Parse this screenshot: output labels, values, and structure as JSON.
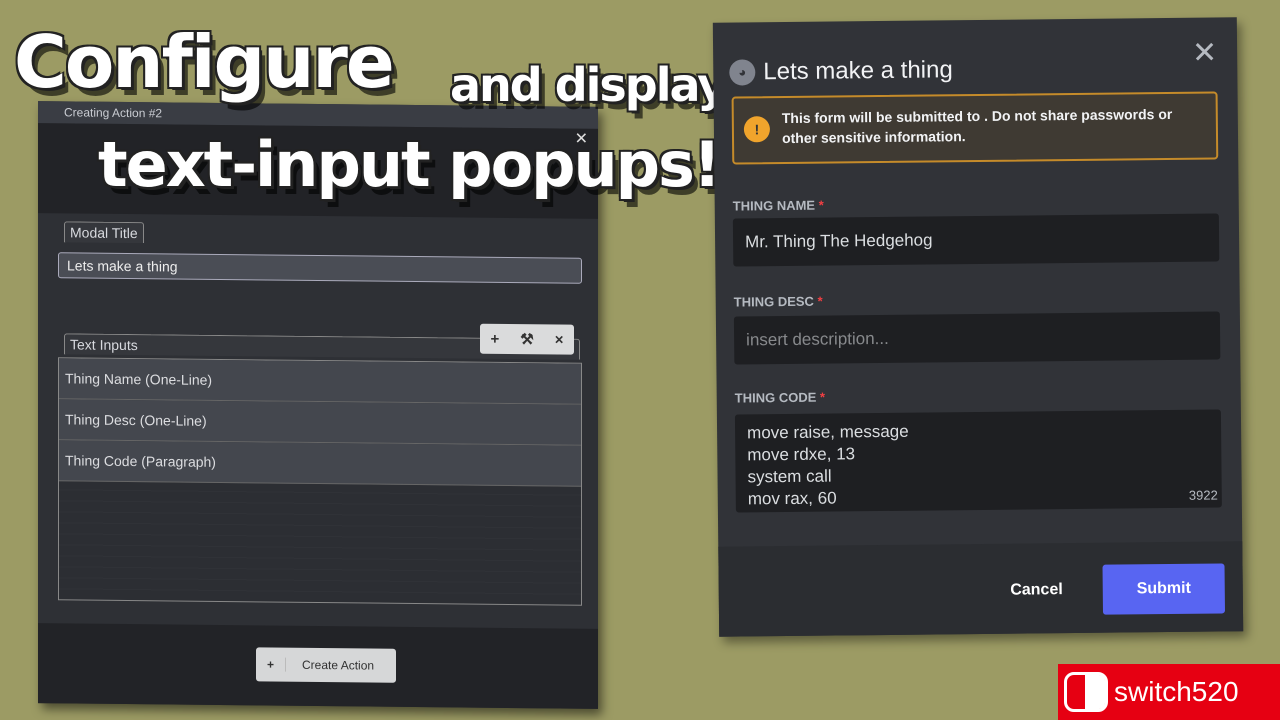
{
  "headline": {
    "line1a": "Configure",
    "line1b": "and display",
    "line2": "text-input popups!"
  },
  "builder": {
    "title": "Creating Action #2",
    "modal_title_label": "Modal Title",
    "modal_title_value": "Lets make a thing",
    "text_inputs_label": "Text Inputs",
    "items": [
      "Thing Name (One-Line)",
      "Thing Desc (One-Line)",
      "Thing Code (Paragraph)"
    ],
    "toolbar": {
      "add": "+",
      "edit": "⚒",
      "remove": "×"
    },
    "create_label": "Create Action",
    "create_icon": "+"
  },
  "modal": {
    "title": "Lets make a thing",
    "warning": "This form will be submitted to            . Do not share passwords or other sensitive information.",
    "fields": [
      {
        "label": "THING NAME",
        "value": "Mr. Thing The Hedgehog"
      },
      {
        "label": "THING DESC",
        "placeholder": "insert description..."
      },
      {
        "label": "THING CODE",
        "value": "move raise, message\nmove rdxe, 13\nsystem call\nmov rax, 60",
        "counter": "3922"
      }
    ],
    "required_mark": "*",
    "cancel": "Cancel",
    "submit": "Submit"
  },
  "watermark": "switch520",
  "colors": {
    "background": "#9c9b64",
    "accent": "#5865f2",
    "warning": "#f0a42c"
  }
}
